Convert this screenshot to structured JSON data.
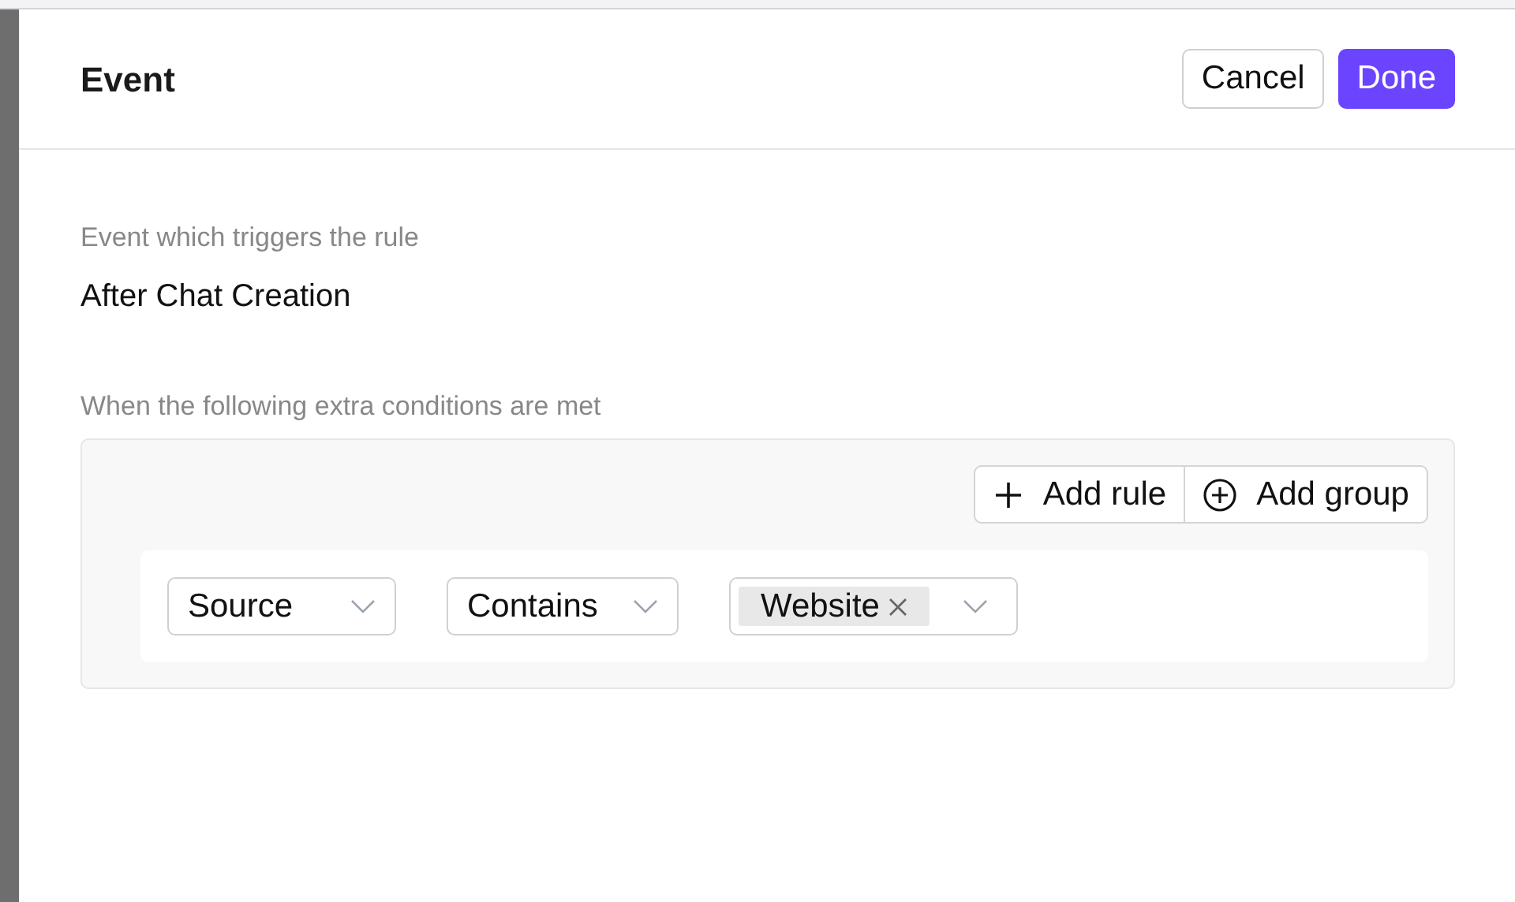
{
  "header": {
    "title": "Event",
    "buttons": [
      {
        "label": "Cancel",
        "kind": "secondary"
      },
      {
        "label": "Done",
        "kind": "primary"
      }
    ]
  },
  "trigger": {
    "label": "Event which triggers the rule",
    "value": "After Chat Creation"
  },
  "conditions": {
    "label": "When the following extra conditions are met",
    "actions": [
      {
        "label": "Add rule",
        "kind": "plus"
      },
      {
        "label": "Add group",
        "kind": "circle-plus"
      }
    ],
    "rule": {
      "field": "Source",
      "operator": "Contains",
      "tags": [
        "Website"
      ]
    }
  }
}
